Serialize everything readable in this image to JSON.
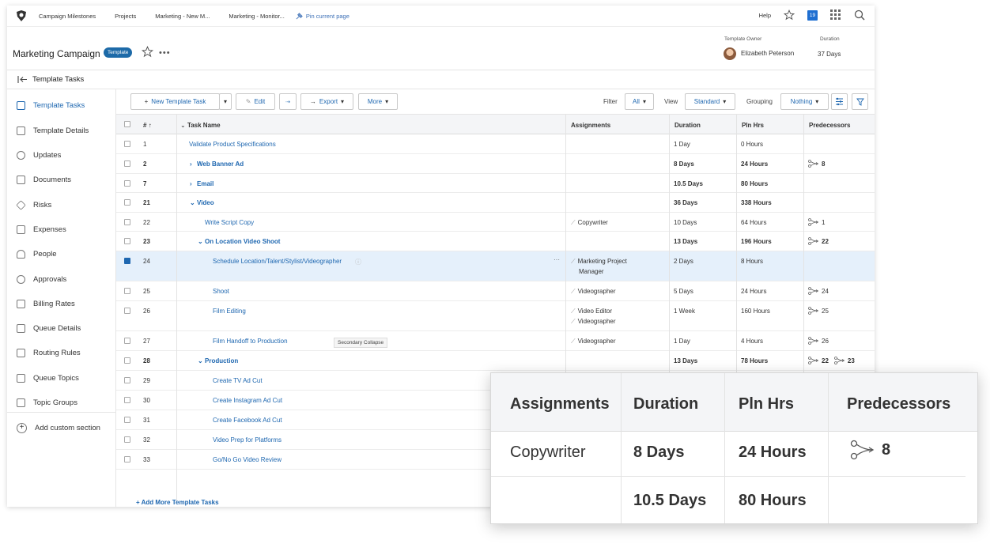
{
  "nav": {
    "tabs": [
      "Campaign Milestones",
      "Projects",
      "Marketing - New M...",
      "Marketing - Monitor..."
    ],
    "pin_label": "Pin current page",
    "help": "Help",
    "calendar_day": "19"
  },
  "header": {
    "title": "Marketing Campaign",
    "badge": "Template",
    "owner_label": "Template Owner",
    "owner_name": "Elizabeth Peterson",
    "duration_label": "Duration",
    "duration_value": "37 Days"
  },
  "breadcrumb": "Template Tasks",
  "sidebar": {
    "items": [
      "Template Tasks",
      "Template Details",
      "Updates",
      "Documents",
      "Risks",
      "Expenses",
      "People",
      "Approvals",
      "Billing Rates",
      "Queue Details",
      "Routing Rules",
      "Queue Topics",
      "Topic Groups"
    ],
    "add_section": "Add custom section"
  },
  "toolbar": {
    "new_task": "New Template Task",
    "edit": "Edit",
    "export": "Export",
    "more": "More",
    "filter_label": "Filter",
    "filter_value": "All",
    "view_label": "View",
    "view_value": "Standard",
    "grouping_label": "Grouping",
    "grouping_value": "Nothing"
  },
  "grid": {
    "headers": {
      "num": "#",
      "task": "Task Name",
      "assign": "Assignments",
      "duration": "Duration",
      "plnhrs": "Pln Hrs",
      "pred": "Predecessors"
    },
    "rows": [
      {
        "num": "1",
        "task": "Validate Product Specifications",
        "assign": "",
        "assign2": "",
        "duration": "1 Day",
        "plnhrs": "0 Hours",
        "pred": ""
      },
      {
        "num": "2",
        "task": "Web Banner Ad",
        "assign": "",
        "assign2": "",
        "duration": "8 Days",
        "plnhrs": "24 Hours",
        "pred": "8"
      },
      {
        "num": "7",
        "task": "Email",
        "assign": "",
        "assign2": "",
        "duration": "10.5 Days",
        "plnhrs": "80 Hours",
        "pred": ""
      },
      {
        "num": "21",
        "task": "Video",
        "assign": "",
        "assign2": "",
        "duration": "36 Days",
        "plnhrs": "338 Hours",
        "pred": ""
      },
      {
        "num": "22",
        "task": "Write Script Copy",
        "assign": "Copywriter",
        "assign2": "",
        "duration": "10 Days",
        "plnhrs": "64 Hours",
        "pred": "1"
      },
      {
        "num": "23",
        "task": "On Location Video Shoot",
        "assign": "",
        "assign2": "",
        "duration": "13 Days",
        "plnhrs": "196 Hours",
        "pred": "22"
      },
      {
        "num": "24",
        "task": "Schedule Location/Talent/Stylist/Videographer",
        "assign": "Marketing Project",
        "assign2": "Manager",
        "duration": "2 Days",
        "plnhrs": "8 Hours",
        "pred": ""
      },
      {
        "num": "25",
        "task": "Shoot",
        "assign": "Videographer",
        "assign2": "",
        "duration": "5 Days",
        "plnhrs": "24 Hours",
        "pred": "24"
      },
      {
        "num": "26",
        "task": "Film Editing",
        "assign": "Video Editor",
        "assign2": "Videographer",
        "duration": "1 Week",
        "plnhrs": "160 Hours",
        "pred": "25"
      },
      {
        "num": "27",
        "task": "Film Handoff to Production",
        "assign": "Videographer",
        "assign2": "",
        "duration": "1 Day",
        "plnhrs": "4 Hours",
        "pred": "26"
      },
      {
        "num": "28",
        "task": "Production",
        "assign": "",
        "assign2": "",
        "duration": "13 Days",
        "plnhrs": "78 Hours",
        "pred": "22",
        "pred2": "23"
      },
      {
        "num": "29",
        "task": "Create TV Ad Cut"
      },
      {
        "num": "30",
        "task": "Create Instagram Ad Cut"
      },
      {
        "num": "31",
        "task": "Create Facebook Ad Cut"
      },
      {
        "num": "32",
        "task": "Video Prep for Platforms"
      },
      {
        "num": "33",
        "task": "Go/No Go Video Review"
      }
    ],
    "add_more": "+ Add More Template Tasks",
    "tooltip": "Secondary Collapse"
  },
  "zoom": {
    "headers": [
      "Assignments",
      "Duration",
      "Pln Hrs",
      "Predecessors"
    ],
    "row1": {
      "assign": "Copywriter",
      "duration": "8 Days",
      "plnhrs": "24 Hours",
      "pred": "8"
    },
    "row2": {
      "duration": "10.5 Days",
      "plnhrs": "80 Hours"
    }
  },
  "colors": {
    "accent": "#1e67b0",
    "badge": "#1d6aa8",
    "selected_row": "#e5f0fb"
  }
}
